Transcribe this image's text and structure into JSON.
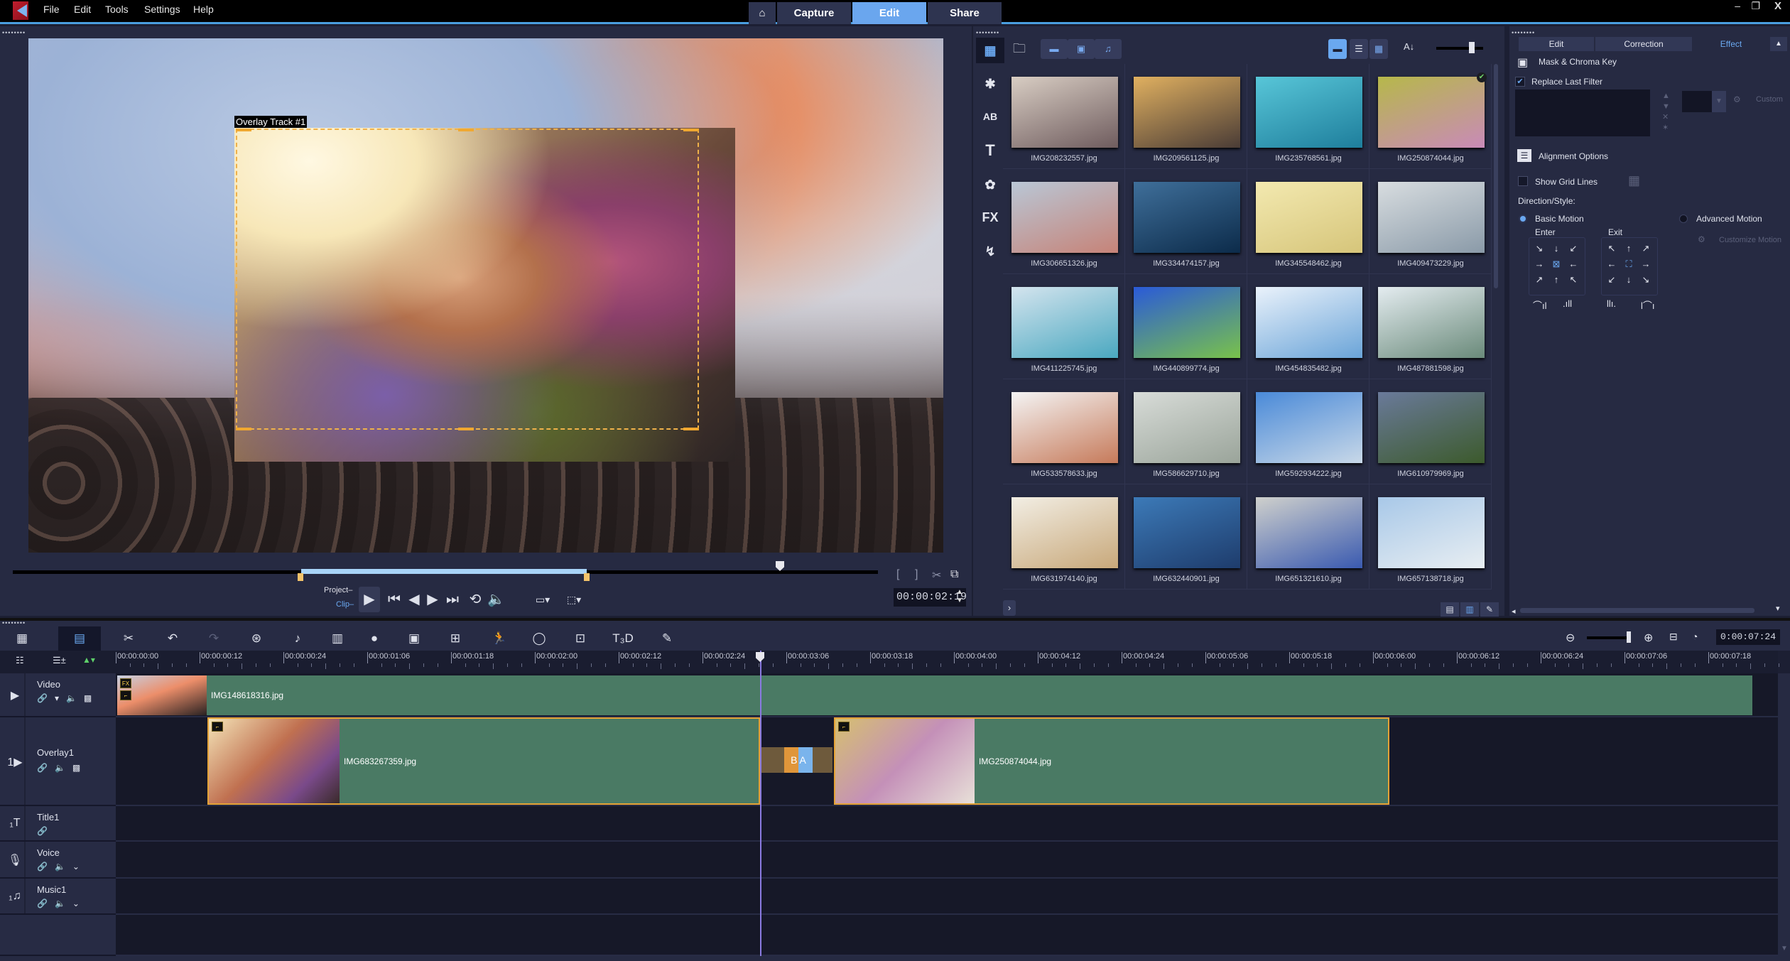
{
  "menu": {
    "file": "File",
    "edit": "Edit",
    "tools": "Tools",
    "settings": "Settings",
    "help": "Help"
  },
  "mode_tabs": {
    "home_icon": "home-icon",
    "capture": "Capture",
    "edit": "Edit",
    "share": "Share",
    "active": "Edit"
  },
  "window_controls": {
    "minimize": "–",
    "restore": "❐",
    "close": "X"
  },
  "preview": {
    "overlay_label": "Overlay Track #1",
    "project_label": "Project–",
    "clip_label": "Clip–",
    "timecode": "00:00:02:19",
    "scrub_mode": "Clip"
  },
  "library": {
    "side_icons": [
      "media",
      "instant-project",
      "transition",
      "title",
      "graphics",
      "filter",
      "path"
    ],
    "fx_label": "FX",
    "toolbar": {
      "show_video": "video",
      "show_photo": "photo",
      "show_audio": "audio"
    },
    "items": [
      {
        "name": "IMG208232557.jpg",
        "colors": [
          "#d8cdc3",
          "#6f5c5e"
        ]
      },
      {
        "name": "IMG209561125.jpg",
        "colors": [
          "#e0b060",
          "#4a3c36"
        ]
      },
      {
        "name": "IMG235768561.jpg",
        "colors": [
          "#58c6d8",
          "#1e7e9c"
        ]
      },
      {
        "name": "IMG250874044.jpg",
        "colors": [
          "#b6b84a",
          "#c98ab8"
        ],
        "checked": true
      },
      {
        "name": "IMG306651326.jpg",
        "colors": [
          "#b9c7d6",
          "#c68378"
        ]
      },
      {
        "name": "IMG334474157.jpg",
        "colors": [
          "#3f6f9a",
          "#0c2b4a"
        ]
      },
      {
        "name": "IMG345548462.jpg",
        "colors": [
          "#f3e9b0",
          "#d6c57a"
        ]
      },
      {
        "name": "IMG409473229.jpg",
        "colors": [
          "#d8dde0",
          "#8a9aa8"
        ]
      },
      {
        "name": "IMG411225745.jpg",
        "colors": [
          "#d4e4ee",
          "#4aa8c0"
        ]
      },
      {
        "name": "IMG440899774.jpg",
        "colors": [
          "#2a5ad8",
          "#79c24a"
        ]
      },
      {
        "name": "IMG454835482.jpg",
        "colors": [
          "#eaf2fb",
          "#6aa4d8"
        ]
      },
      {
        "name": "IMG487881598.jpg",
        "colors": [
          "#e4ecf0",
          "#6a8a7a"
        ]
      },
      {
        "name": "IMG533578633.jpg",
        "colors": [
          "#f4f4f4",
          "#c67a5a"
        ]
      },
      {
        "name": "IMG586629710.jpg",
        "colors": [
          "#d8dcd8",
          "#9aa49a"
        ]
      },
      {
        "name": "IMG592934222.jpg",
        "colors": [
          "#4a8ad8",
          "#c8d8e8"
        ]
      },
      {
        "name": "IMG610979969.jpg",
        "colors": [
          "#6a7a9a",
          "#3c5a2c"
        ]
      },
      {
        "name": "IMG631974140.jpg",
        "colors": [
          "#f2eee4",
          "#c8a87a"
        ]
      },
      {
        "name": "IMG632440901.jpg",
        "colors": [
          "#3c7ab8",
          "#1e3c6c"
        ]
      },
      {
        "name": "IMG651321610.jpg",
        "colors": [
          "#cfd0cc",
          "#3a5ab0"
        ]
      },
      {
        "name": "IMG657138718.jpg",
        "colors": [
          "#a8c8e8",
          "#e8eef2"
        ]
      }
    ]
  },
  "options": {
    "tabs": [
      "Edit",
      "Correction",
      "Effect"
    ],
    "active_tab": "Effect",
    "mask_chroma": "Mask & Chroma Key",
    "replace_last_filter": {
      "label": "Replace Last Filter",
      "checked": true
    },
    "custom_label": "Custom",
    "alignment_options": "Alignment Options",
    "show_grid_lines": {
      "label": "Show Grid Lines",
      "checked": false
    },
    "direction_style": "Direction/Style:",
    "basic_motion": {
      "label": "Basic Motion",
      "selected": true
    },
    "advanced_motion": {
      "label": "Advanced Motion",
      "selected": false
    },
    "customize_motion": "Customize Motion",
    "enter_label": "Enter",
    "exit_label": "Exit",
    "enter_arrows": [
      "↘",
      "↓",
      "↙",
      "→",
      "⊠",
      "←",
      "↗",
      "↑",
      "↖"
    ],
    "exit_arrows": [
      "↖",
      "↑",
      "↗",
      "←",
      "⛶",
      "→",
      "↙",
      "↓",
      "↘"
    ]
  },
  "timeline": {
    "zoom_timecode": "0:00:07:24",
    "ruler": [
      "00:00:00:00",
      "00:00:00:12",
      "00:00:00:24",
      "00:00:01:06",
      "00:00:01:18",
      "00:00:02:00",
      "00:00:02:12",
      "00:00:02:24",
      "00:00:03:06",
      "00:00:03:18",
      "00:00:04:00",
      "00:00:04:12",
      "00:00:04:24",
      "00:00:05:06",
      "00:00:05:18",
      "00:00:06:00",
      "00:00:06:12",
      "00:00:06:24",
      "00:00:07:06",
      "00:00:07:18"
    ],
    "playhead": "00:00:02:19",
    "tracks": [
      {
        "name": "Video",
        "clips": [
          {
            "name": "IMG148618316.jpg",
            "fx": true
          }
        ]
      },
      {
        "name": "Overlay1",
        "clips": [
          {
            "name": "IMG683267359.jpg"
          },
          {
            "name": "IMG250874044.jpg"
          }
        ],
        "transition": true
      },
      {
        "name": "Title1",
        "clips": []
      },
      {
        "name": "Voice",
        "clips": []
      },
      {
        "name": "Music1",
        "clips": []
      }
    ]
  }
}
